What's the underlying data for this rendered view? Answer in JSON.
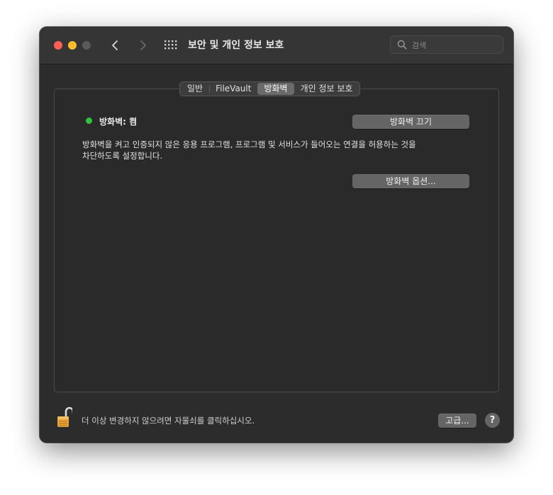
{
  "window": {
    "title": "보안 및 개인 정보 보호",
    "search_placeholder": "검색"
  },
  "tabs": [
    {
      "label": "일반",
      "active": false
    },
    {
      "label": "FileVault",
      "active": false
    },
    {
      "label": "방화벽",
      "active": true
    },
    {
      "label": "개인 정보 보호",
      "active": false
    }
  ],
  "firewall": {
    "status_label": "방화벽: 켬",
    "status_color": "#31c13f",
    "turn_off_button": "방화벽 끄기",
    "description_line1": "방화벽을 켜고 인증되지 않은 응용 프로그램, 프로그램 및 서비스가 들어오는 연결을 허용하는 것을",
    "description_line2": "차단하도록 설정합니다.",
    "options_button": "방화벽 옵션..."
  },
  "footer": {
    "lock_text": "더 이상 변경하지 않으려면 자물쇠를 클릭하십시오.",
    "advanced_button": "고급...",
    "help_label": "?"
  },
  "colors": {
    "close": "#fe5f57",
    "minimize": "#febc2e",
    "lock": "#e8a33a"
  }
}
